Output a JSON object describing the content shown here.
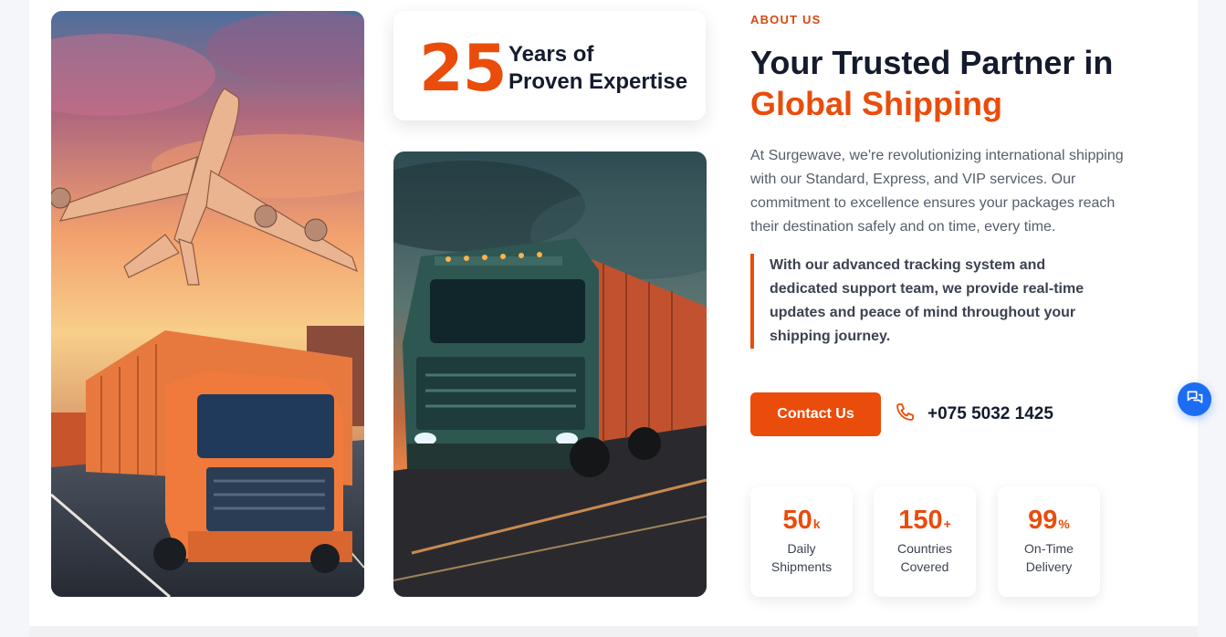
{
  "colors": {
    "accent": "#ea4c0b",
    "heading": "#141b2d",
    "body_text": "#565d6b",
    "chat_button": "#1d6df2"
  },
  "images": {
    "left": "cargo-plane-and-orange-truck-photo",
    "right": "green-truck-with-container-photo"
  },
  "experience_card": {
    "number": "25",
    "line1": "Years of",
    "line2": "Proven Expertise"
  },
  "about": {
    "eyebrow": "ABOUT US",
    "title_line1": "Your Trusted Partner in",
    "title_line2": "Global Shipping",
    "intro": "At Surgewave, we're revolutionizing international shipping with our Standard, Express, and VIP services. Our commitment to excellence ensures your packages reach their destination safely and on time, every time.",
    "quote": "With our advanced tracking system and dedicated support team, we provide real-time updates and peace of mind throughout your shipping journey."
  },
  "cta": {
    "contact_label": "Contact Us",
    "phone_icon": "phone-icon",
    "phone_number": "+075 5032 1425"
  },
  "stats": [
    {
      "value": "50",
      "suffix": "k",
      "label_line1": "Daily",
      "label_line2": "Shipments"
    },
    {
      "value": "150",
      "suffix": "+",
      "label_line1": "Countries",
      "label_line2": "Covered"
    },
    {
      "value": "99",
      "suffix": "%",
      "label_line1": "On-Time",
      "label_line2": "Delivery"
    }
  ],
  "chat_button": {
    "icon": "chat-bubbles-icon"
  }
}
